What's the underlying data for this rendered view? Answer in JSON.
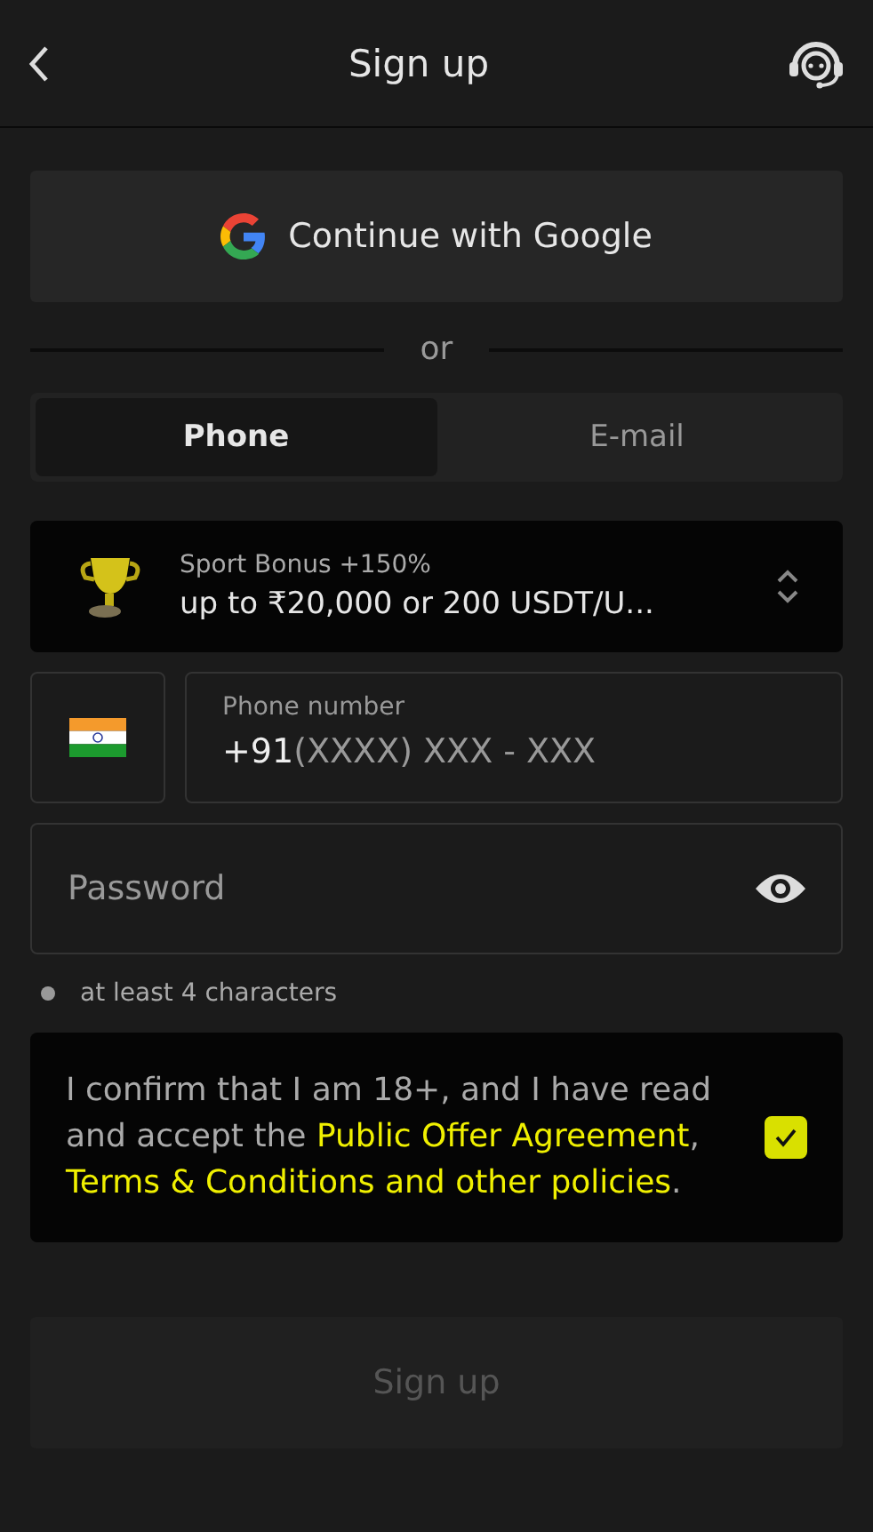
{
  "header": {
    "title": "Sign up"
  },
  "google_button": {
    "label": "Continue with Google"
  },
  "divider": {
    "label": "or"
  },
  "tabs": [
    {
      "label": "Phone",
      "selected": true
    },
    {
      "label": "E-mail",
      "selected": false
    }
  ],
  "bonus": {
    "title": "Sport Bonus +150%",
    "value": "up to ₹20,000 or 200 USDT/U..."
  },
  "phone": {
    "label": "Phone number",
    "prefix": "+91",
    "placeholder": "(XXXX) XXX - XXX"
  },
  "password": {
    "placeholder": "Password"
  },
  "hint": {
    "text": "at least 4 characters"
  },
  "consent": {
    "checked": true,
    "parts": [
      {
        "kind": "text",
        "text": "I confirm that I am 18+, and I have read and accept the "
      },
      {
        "kind": "link",
        "text": "Public Offer Agreement"
      },
      {
        "kind": "text",
        "text": ", "
      },
      {
        "kind": "link",
        "text": "Terms & Conditions and other policies"
      },
      {
        "kind": "text",
        "text": "."
      }
    ]
  },
  "submit": {
    "label": "Sign up",
    "disabled": true
  }
}
